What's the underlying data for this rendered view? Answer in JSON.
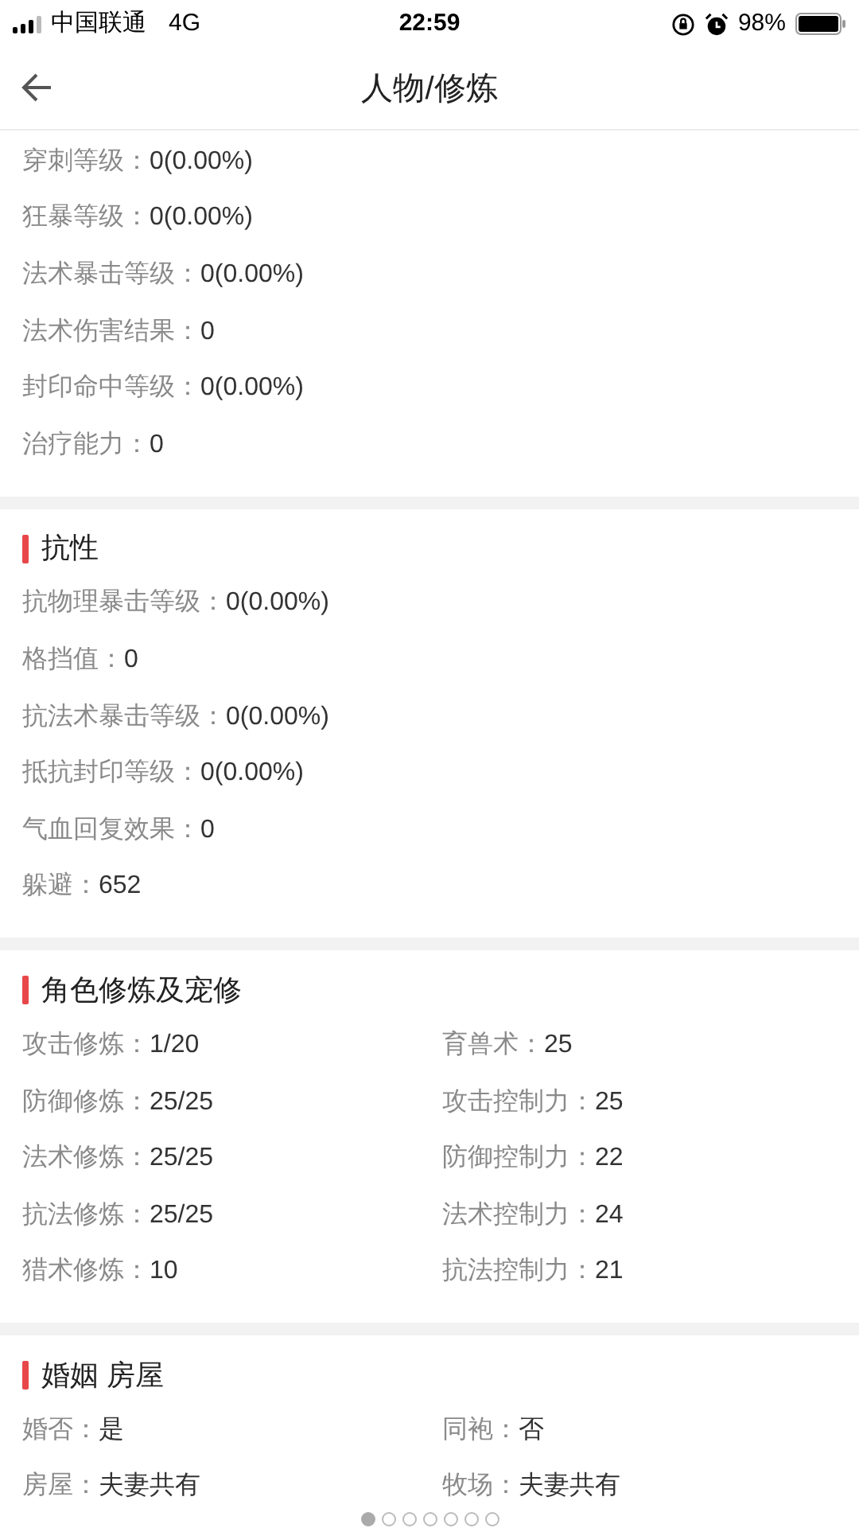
{
  "status_bar": {
    "carrier": "中国联通",
    "network": "4G",
    "time": "22:59",
    "battery": "98%"
  },
  "header": {
    "title": "人物/修炼"
  },
  "sections": [
    {
      "kind": "list",
      "items": [
        {
          "label": "穿刺等级：",
          "value": "0(0.00%)"
        },
        {
          "label": "狂暴等级：",
          "value": "0(0.00%)"
        },
        {
          "label": "法术暴击等级：",
          "value": "0(0.00%)"
        },
        {
          "label": "法术伤害结果：",
          "value": "0"
        },
        {
          "label": "封印命中等级：",
          "value": "0(0.00%)"
        },
        {
          "label": "治疗能力：",
          "value": "0"
        }
      ]
    },
    {
      "kind": "list",
      "title": "抗性",
      "items": [
        {
          "label": "抗物理暴击等级：",
          "value": "0(0.00%)"
        },
        {
          "label": "格挡值：",
          "value": "0"
        },
        {
          "label": "抗法术暴击等级：",
          "value": "0(0.00%)"
        },
        {
          "label": "抵抗封印等级：",
          "value": "0(0.00%)"
        },
        {
          "label": "气血回复效果：",
          "value": "0"
        },
        {
          "label": "躲避：",
          "value": "652"
        }
      ]
    },
    {
      "kind": "grid",
      "title": "角色修炼及宠修",
      "items": [
        {
          "label": "攻击修炼：",
          "value": "1/20"
        },
        {
          "label": "育兽术：",
          "value": "25"
        },
        {
          "label": "防御修炼：",
          "value": "25/25"
        },
        {
          "label": "攻击控制力：",
          "value": "25"
        },
        {
          "label": "法术修炼：",
          "value": "25/25"
        },
        {
          "label": "防御控制力：",
          "value": "22"
        },
        {
          "label": "抗法修炼：",
          "value": "25/25"
        },
        {
          "label": "法术控制力：",
          "value": "24"
        },
        {
          "label": "猎术修炼：",
          "value": "10"
        },
        {
          "label": "抗法控制力：",
          "value": "21"
        }
      ]
    },
    {
      "kind": "grid",
      "title": "婚姻 房屋",
      "items": [
        {
          "label": "婚否：",
          "value": "是"
        },
        {
          "label": "同袍：",
          "value": "否"
        },
        {
          "label": "房屋：",
          "value": "夫妻共有"
        },
        {
          "label": "牧场：",
          "value": "夫妻共有"
        }
      ]
    }
  ],
  "page_dots": [
    {
      "selected": true
    },
    {
      "selected": false
    },
    {
      "selected": false
    },
    {
      "selected": false
    },
    {
      "selected": false
    },
    {
      "selected": false
    },
    {
      "selected": false
    }
  ]
}
